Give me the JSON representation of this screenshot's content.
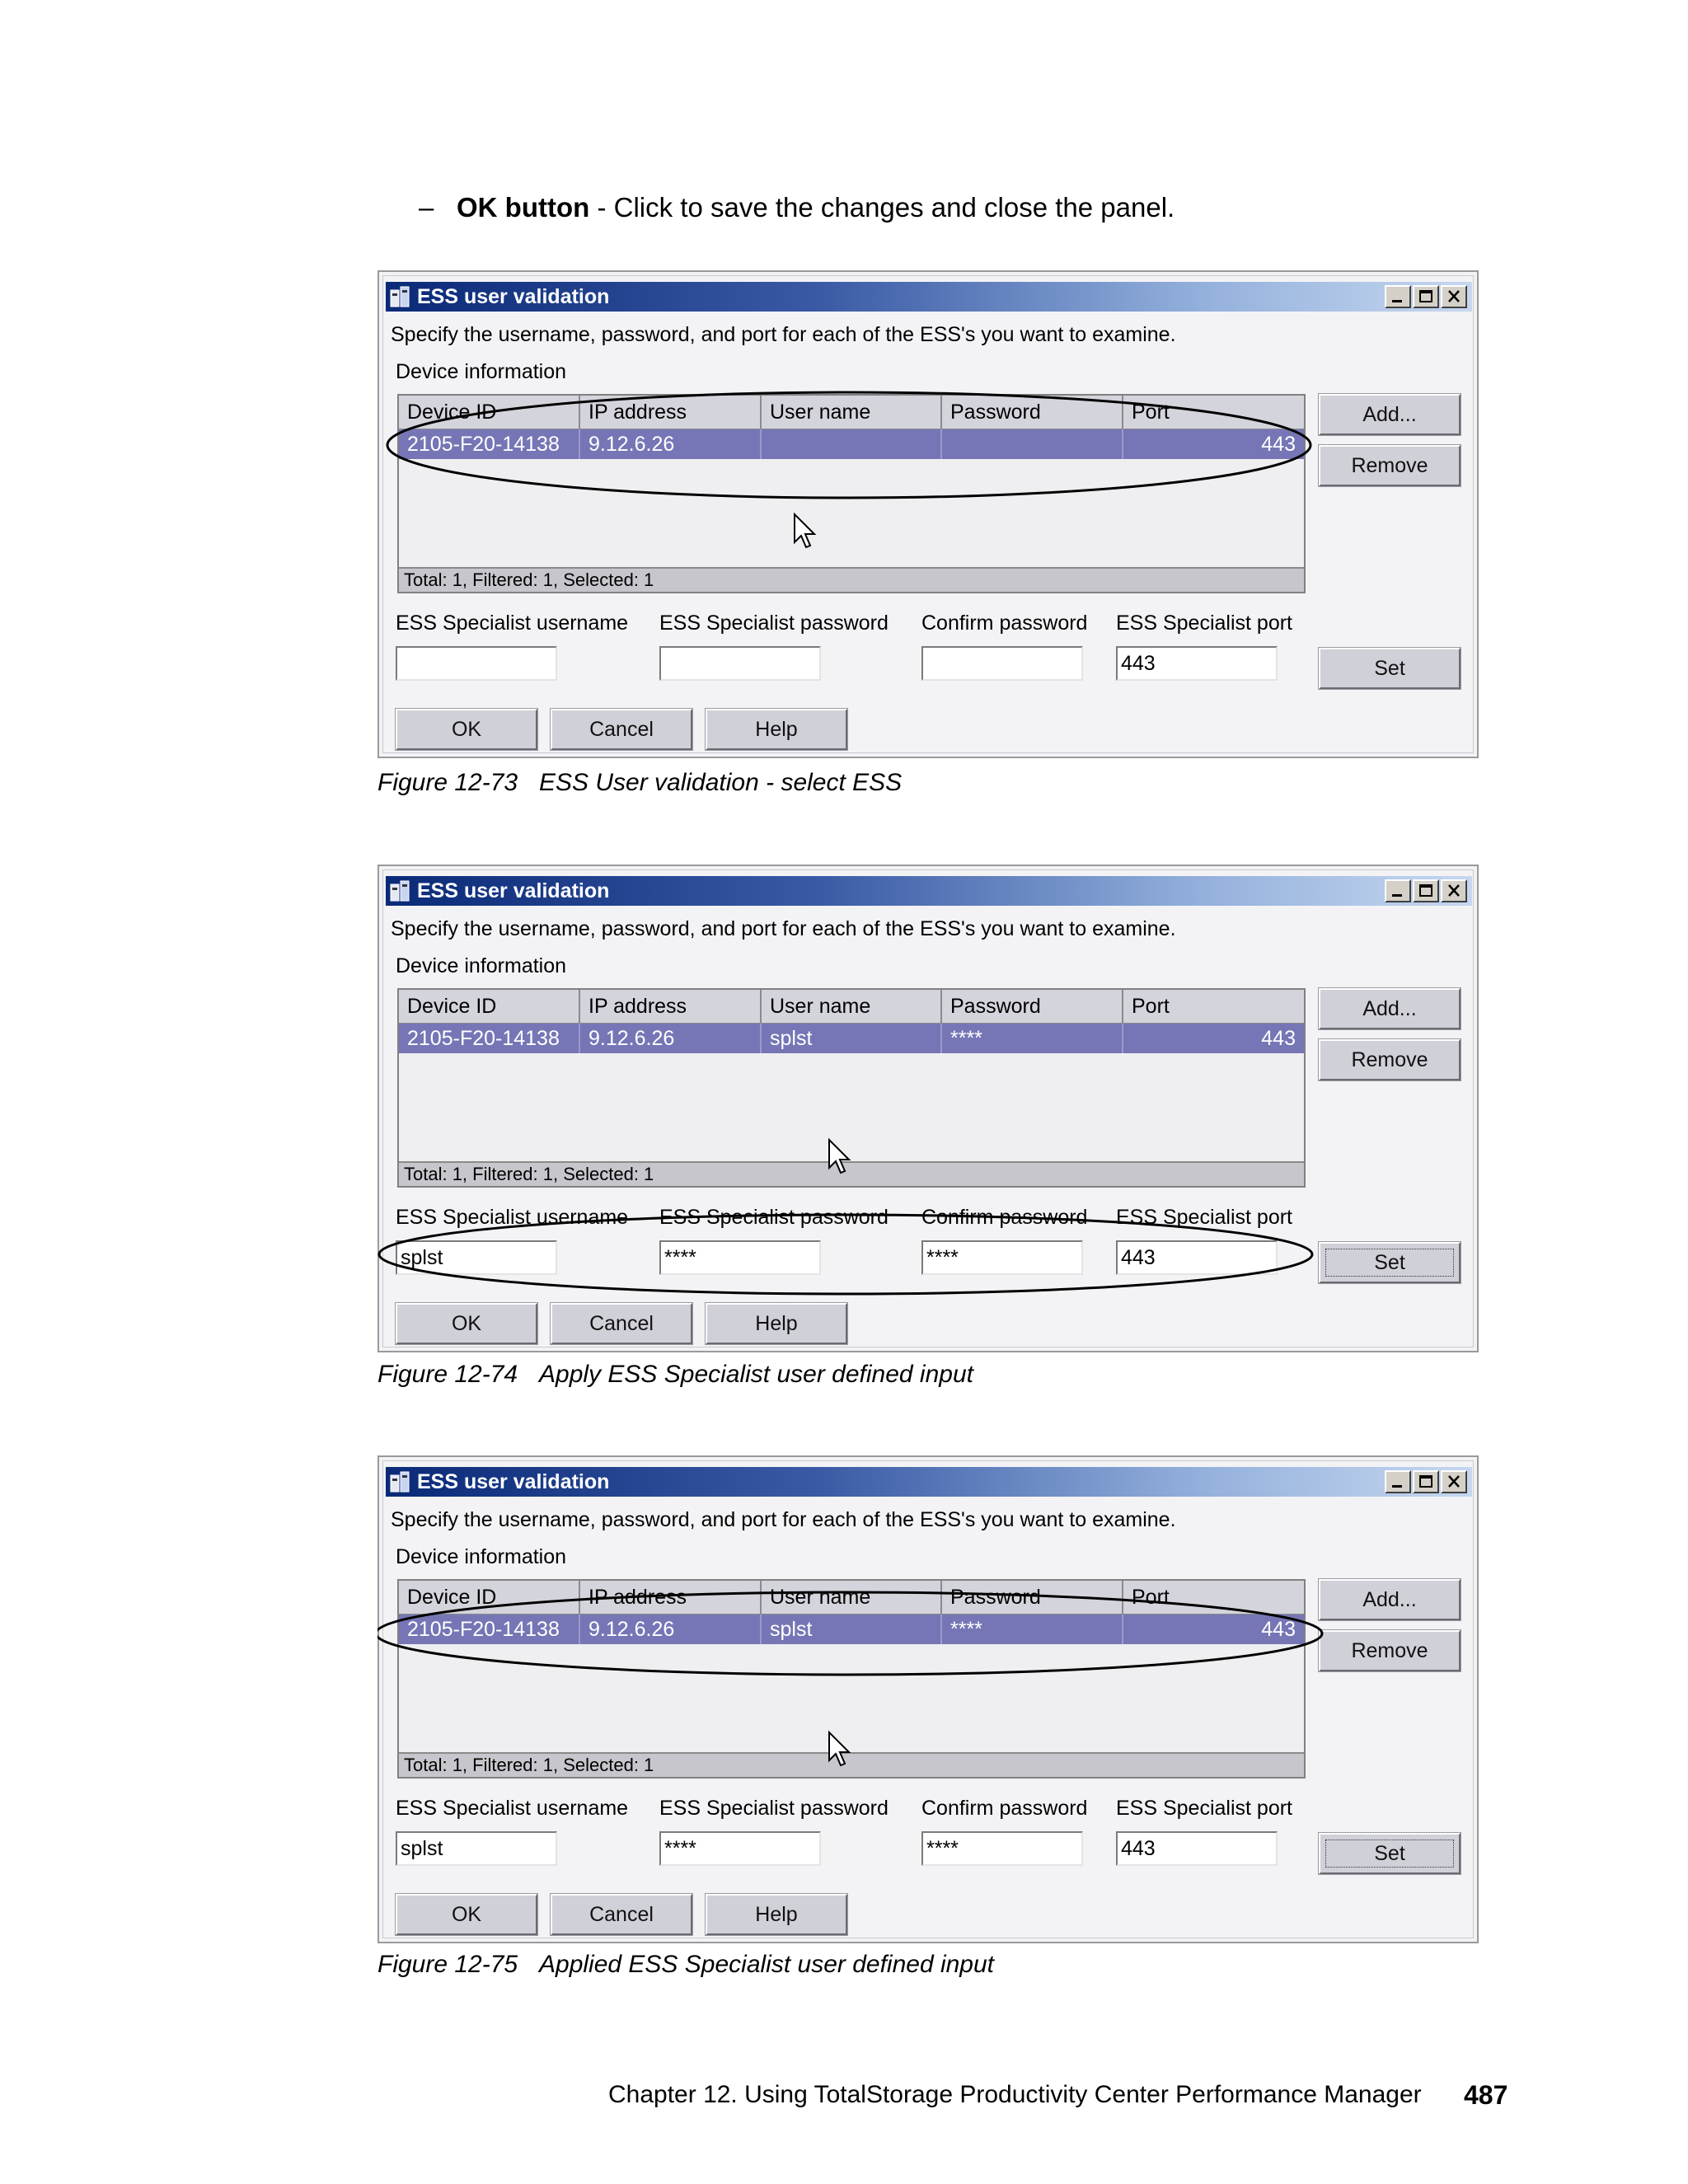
{
  "intro": {
    "dash": "–",
    "bold": "OK button",
    "rest": " - Click to save the changes and close the panel."
  },
  "dialog": {
    "title": "ESS user validation",
    "instruction": "Specify the username, password, and port for each of the ESS's you want to examine.",
    "group_label": "Device information",
    "columns": [
      "Device ID",
      "IP address",
      "User name",
      "Password",
      "Port"
    ],
    "footer_status": "Total: 1, Filtered: 1, Selected: 1",
    "field_labels": [
      "ESS Specialist username",
      "ESS Specialist password",
      "Confirm password",
      "ESS Specialist port"
    ],
    "buttons": {
      "add": "Add...",
      "remove": "Remove",
      "set": "Set",
      "ok": "OK",
      "cancel": "Cancel",
      "help": "Help"
    }
  },
  "figures": [
    {
      "row": [
        "2105-F20-14138",
        "9.12.6.26",
        "",
        "",
        "443"
      ],
      "fields": [
        "",
        "",
        "",
        "443"
      ],
      "caption_num": "Figure 12-73",
      "caption_text": "ESS User validation - select ESS"
    },
    {
      "row": [
        "2105-F20-14138",
        "9.12.6.26",
        "splst",
        "****",
        "443"
      ],
      "fields": [
        "splst",
        "****",
        "****",
        "443"
      ],
      "caption_num": "Figure 12-74",
      "caption_text": "Apply ESS Specialist user defined input"
    },
    {
      "row": [
        "2105-F20-14138",
        "9.12.6.26",
        "splst",
        "****",
        "443"
      ],
      "fields": [
        "splst",
        "****",
        "****",
        "443"
      ],
      "caption_num": "Figure 12-75",
      "caption_text": "Applied ESS Specialist user defined input"
    }
  ],
  "footer": {
    "chapter": "Chapter 12. Using TotalStorage Productivity Center Performance Manager",
    "page": "487"
  }
}
